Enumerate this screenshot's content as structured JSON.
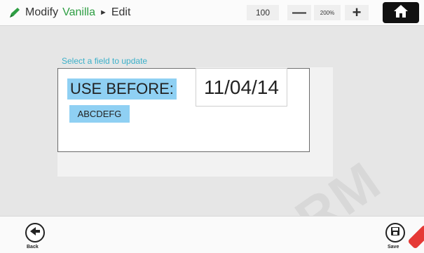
{
  "header": {
    "mode": "Modify",
    "item": "Vanilla",
    "separator": "►",
    "action": "Edit",
    "zoom_value": "100",
    "zoom_minus": "—",
    "zoom_max": "200%",
    "zoom_plus": "+"
  },
  "editor": {
    "hint": "Select a field to update",
    "use_before_label": "USE BEFORE:",
    "date_value": "11/04/14",
    "code_value": "ABCDEFG"
  },
  "footer": {
    "back_label": "Back",
    "save_label": "Save"
  },
  "watermark": "RM",
  "colors": {
    "brand_green": "#2e9e43",
    "hint_blue": "#3bb0c9",
    "field_highlight": "#8fd0f3"
  },
  "icons": {
    "edit": "pencil-icon",
    "home": "home-icon",
    "back": "arrow-left-icon",
    "save": "floppy-disk-icon"
  }
}
